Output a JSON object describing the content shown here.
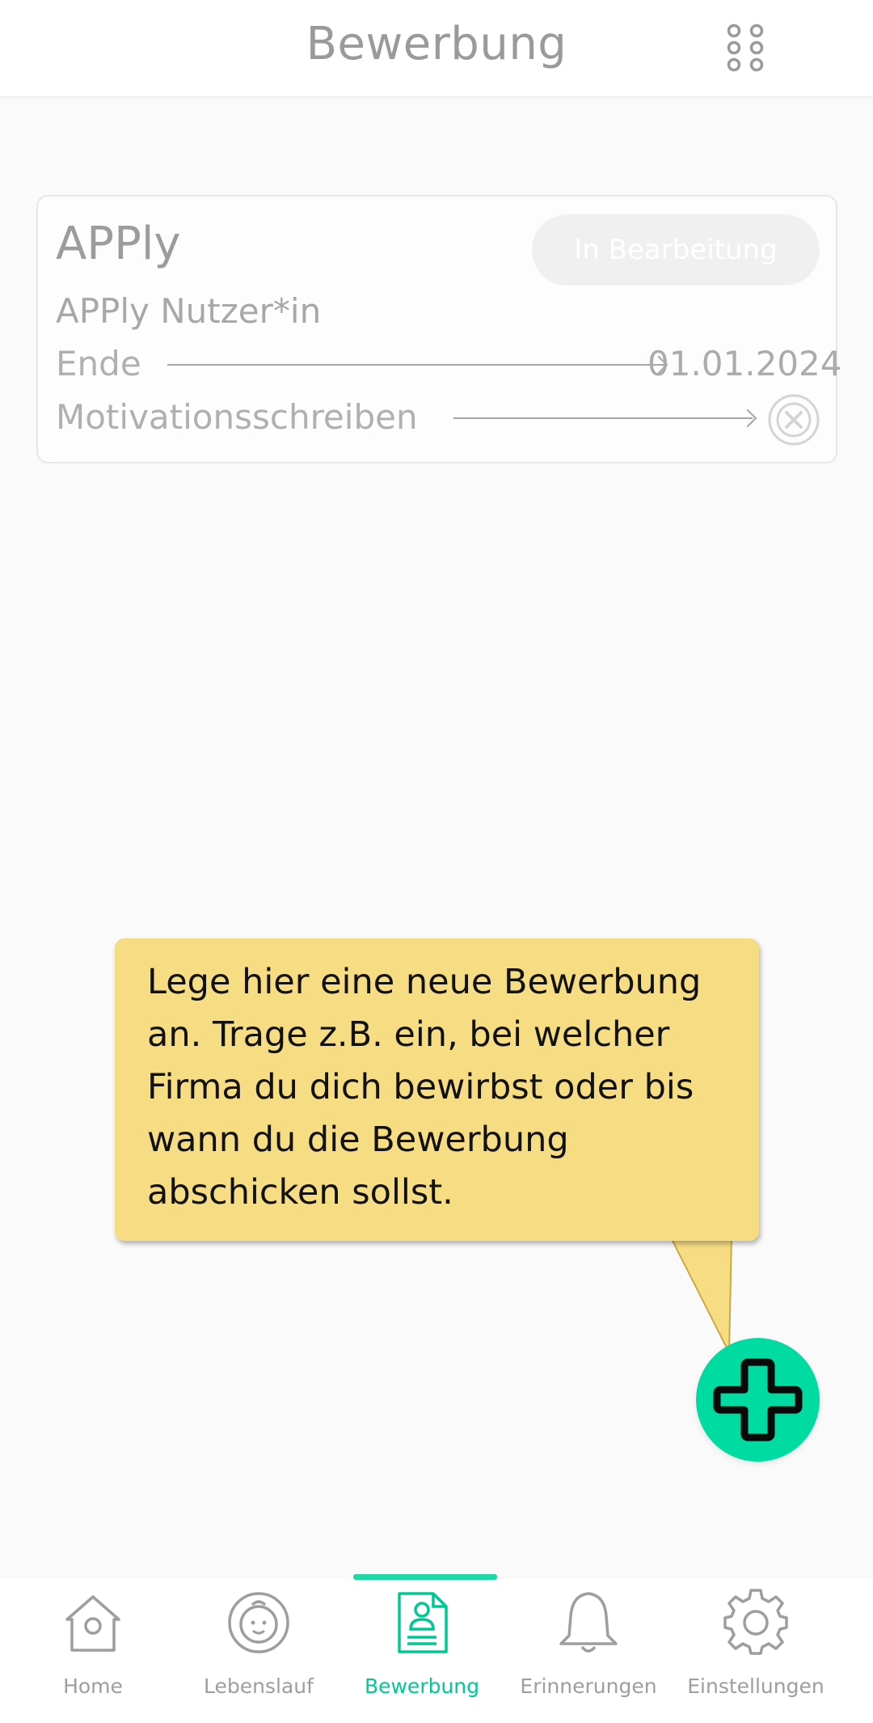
{
  "header": {
    "title": "Bewerbung",
    "menu_icon": "grid-dots-icon"
  },
  "card": {
    "title": "APPly",
    "status": "In Bearbeitung",
    "subtitle": "APPly Nutzer*in",
    "rows": [
      {
        "label": "Ende",
        "value": "01.01.2024"
      },
      {
        "label": "Motivationsschreiben",
        "value": "",
        "icon": "remove-circle-icon"
      }
    ]
  },
  "tooltip": {
    "text": "Lege hier eine neue Bewerbung an. Trage z.B. ein, bei welcher Firma du dich bewirbst oder bis wann du die Bewerbung abschicken sollst."
  },
  "fab": {
    "icon": "plus-icon"
  },
  "nav": {
    "active_index": 2,
    "items": [
      {
        "label": "Home",
        "icon": "home-icon"
      },
      {
        "label": "Lebenslauf",
        "icon": "face-icon"
      },
      {
        "label": "Bewerbung",
        "icon": "document-person-icon"
      },
      {
        "label": "Erinnerungen",
        "icon": "bell-icon"
      },
      {
        "label": "Einstellungen",
        "icon": "gear-icon"
      }
    ]
  },
  "colors": {
    "accent": "#00dba2",
    "tooltip_bg": "#f6dd84",
    "muted_text": "#a8a8a8"
  }
}
